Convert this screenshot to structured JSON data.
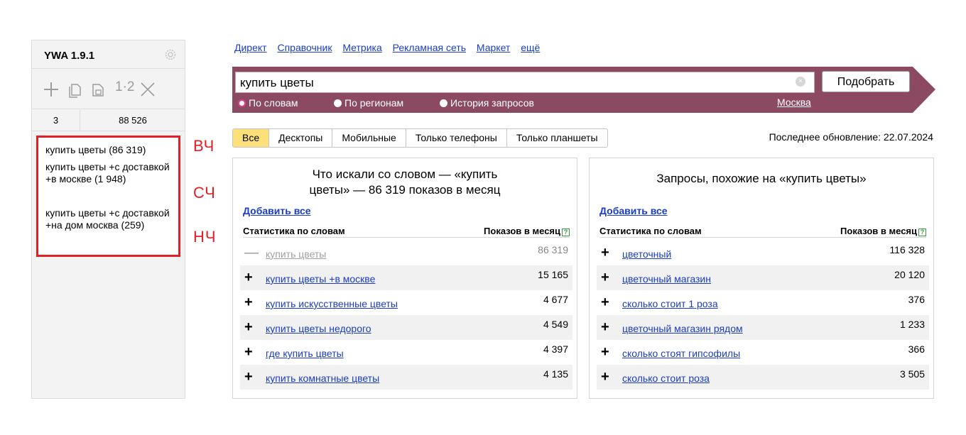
{
  "ywa": {
    "title": "YWA 1.9.1",
    "split_label": "1·2",
    "count_left": "3",
    "count_right": "88 526",
    "keywords": [
      "купить цветы (86 319)",
      "купить цветы +с доставкой +в москве (1 948)",
      "купить цветы +с доставкой +на дом москва (259)"
    ]
  },
  "markers": [
    "ВЧ",
    "СЧ",
    "НЧ"
  ],
  "nav": [
    "Директ",
    "Справочник",
    "Метрика",
    "Рекламная сеть",
    "Маркет",
    "ещё"
  ],
  "search": {
    "query": "купить цветы",
    "button": "Подобрать",
    "modes": [
      "По словам",
      "По регионам",
      "История запросов"
    ],
    "region": "Москва"
  },
  "tabs": [
    "Все",
    "Десктопы",
    "Мобильные",
    "Только телефоны",
    "Только планшеты"
  ],
  "updated": "Последнее обновление: 22.07.2024",
  "left_panel": {
    "title_line1": "Что искали со словом  —  «купить",
    "title_line2": "цветы» — 86 319 показов в месяц",
    "add_all": "Добавить все",
    "col1": "Статистика по словам",
    "col2": "Показов в месяц",
    "rows": [
      {
        "sign": "—",
        "text": "купить цветы",
        "num": "86 319"
      },
      {
        "sign": "+",
        "text": "купить цветы +в москве",
        "num": "15 165"
      },
      {
        "sign": "+",
        "text": "купить искусственные цветы",
        "num": "4 677"
      },
      {
        "sign": "+",
        "text": "купить цветы недорого",
        "num": "4 549"
      },
      {
        "sign": "+",
        "text": "где купить цветы",
        "num": "4 397"
      },
      {
        "sign": "+",
        "text": "купить комнатные цветы",
        "num": "4 135"
      }
    ]
  },
  "right_panel": {
    "title": "Запросы, похожие на «купить цветы»",
    "add_all": "Добавить все",
    "col1": "Статистика по словам",
    "col2": "Показов в месяц",
    "rows": [
      {
        "sign": "+",
        "text": "цветочный",
        "num": "116 328"
      },
      {
        "sign": "+",
        "text": "цветочный магазин",
        "num": "20 120"
      },
      {
        "sign": "+",
        "text": "сколько стоит 1 роза",
        "num": "376"
      },
      {
        "sign": "+",
        "text": "цветочный магазин рядом",
        "num": "1 233"
      },
      {
        "sign": "+",
        "text": "сколько стоят гипсофилы",
        "num": "366"
      },
      {
        "sign": "+",
        "text": "сколько стоит роза",
        "num": "3 505"
      }
    ]
  },
  "question_glyph": "?",
  "clear_glyph": "×"
}
